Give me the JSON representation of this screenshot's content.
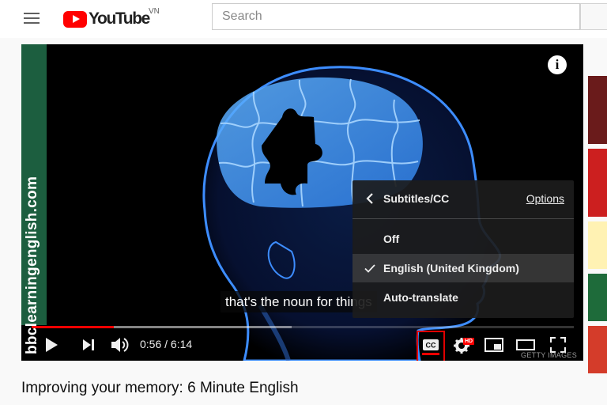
{
  "header": {
    "logo_text": "YouTube",
    "region": "VN",
    "search_placeholder": "Search"
  },
  "player": {
    "side_banner_text": "bbclearningenglish.com",
    "caption": "that's the noun for things",
    "watermark": "GETTY IMAGES",
    "progress": {
      "played_fraction": 0.152,
      "buffered_fraction": 0.48
    },
    "controls": {
      "current_time": "0:56",
      "duration": "6:14",
      "time_separator": " / ",
      "hd_badge": "HD"
    }
  },
  "settings_menu": {
    "title": "Subtitles/CC",
    "options_label": "Options",
    "items": [
      {
        "label": "Off",
        "selected": false
      },
      {
        "label": "English (United Kingdom)",
        "selected": true
      },
      {
        "label": "Auto-translate",
        "selected": false
      }
    ]
  },
  "video": {
    "title": "Improving your memory: 6 Minute English"
  },
  "colors": {
    "brand_red": "#ff0000",
    "banner_green": "#1c5e3f",
    "brain_blue": "#4aa0ff",
    "highlight_red": "#e00000"
  },
  "icons": [
    "menu-icon",
    "youtube-logo-icon",
    "info-icon",
    "chevron-left-icon",
    "check-icon",
    "play-icon",
    "next-icon",
    "volume-icon",
    "subtitles-icon",
    "settings-gear-icon",
    "miniplayer-icon",
    "theater-mode-icon",
    "fullscreen-icon"
  ]
}
